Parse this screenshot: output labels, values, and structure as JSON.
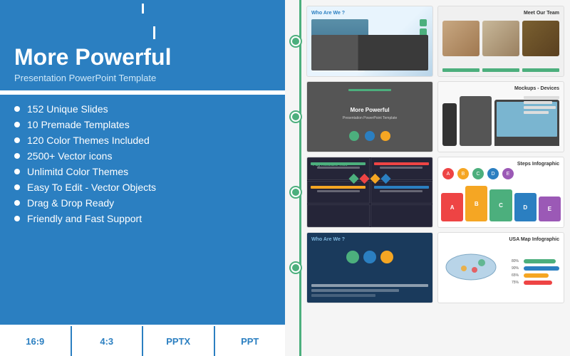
{
  "left": {
    "title": "More Powerful",
    "subtitle": "Presentation PowerPoint Template",
    "features": [
      "152 Unique Slides",
      "10 Premade Templates",
      "120 Color Themes Included",
      "2500+ Vector icons",
      "Unlimitd Color Themes",
      "Easy To Edit - Vector Objects",
      "Drag & Drop Ready",
      "Friendly and Fast Support"
    ],
    "formats": [
      "16:9",
      "4:3",
      "PPTX",
      "PPT"
    ]
  },
  "slides": {
    "row1": [
      {
        "title": "Who Are We ?",
        "type": "who-are-we"
      },
      {
        "title": "Meet Our Team",
        "type": "meet-team"
      }
    ],
    "row2": [
      {
        "title": "More Powerful",
        "type": "more-powerful"
      },
      {
        "title": "Mockups - Devices",
        "type": "mockups"
      }
    ],
    "row3": [
      {
        "title": "Pay Amount Title",
        "type": "pay-amount"
      },
      {
        "title": "Steps Infographic",
        "type": "steps"
      }
    ],
    "row4": [
      {
        "title": "Who Are We ?",
        "type": "who-are-we2"
      },
      {
        "title": "USA Map Infographic",
        "type": "usa-map"
      }
    ]
  },
  "colors": {
    "primary": "#2b7fc1",
    "accent": "#4caf7d",
    "white": "#ffffff",
    "dark": "#333333"
  }
}
